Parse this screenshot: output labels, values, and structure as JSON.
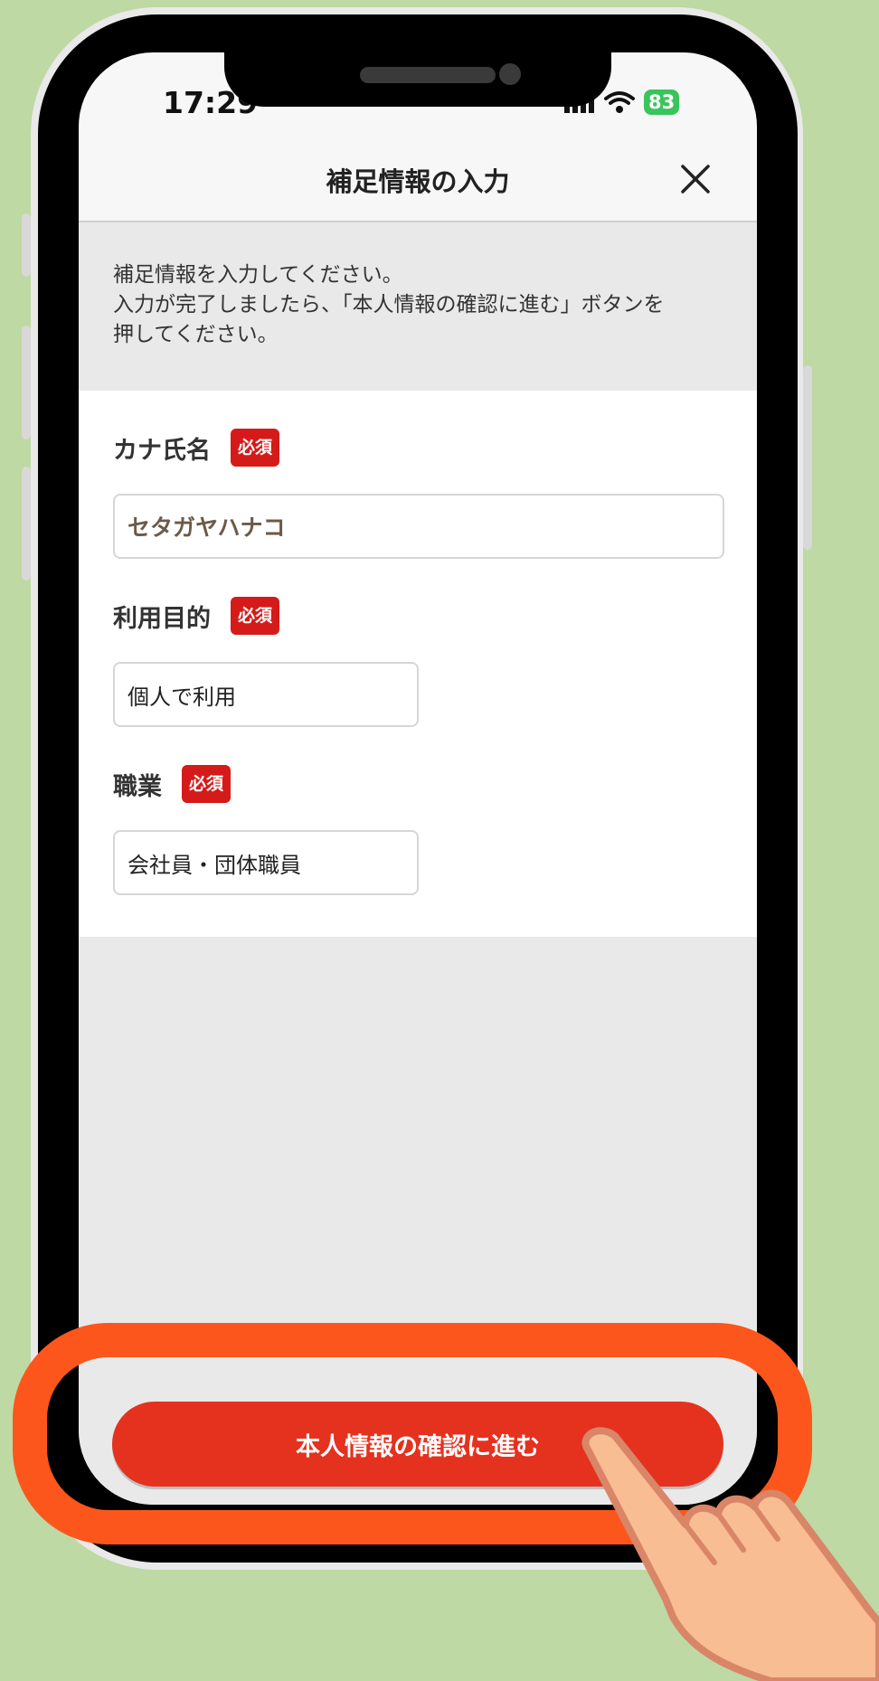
{
  "status": {
    "time": "17:29",
    "battery": "83"
  },
  "header": {
    "title": "補足情報の入力"
  },
  "intro": {
    "text": "補足情報を入力してください。\n入力が完了しましたら、「本人情報の確認に進む」ボタンを\n押してください。"
  },
  "fields": [
    {
      "label": "カナ氏名",
      "badge": "必須",
      "value": "セタガヤハナコ"
    },
    {
      "label": "利用目的",
      "badge": "必須",
      "value": "個人で利用"
    },
    {
      "label": "職業",
      "badge": "必須",
      "value": "会社員・団体職員"
    }
  ],
  "cta": {
    "label": "本人情報の確認に進む"
  },
  "colors": {
    "accent": "#e4321f",
    "badge": "#d51a1a",
    "highlight": "#fc561c",
    "background": "#bed9a3"
  },
  "icons": [
    "close-icon",
    "signal-icon",
    "wifi-icon",
    "battery-icon",
    "hand-pointer-icon"
  ]
}
